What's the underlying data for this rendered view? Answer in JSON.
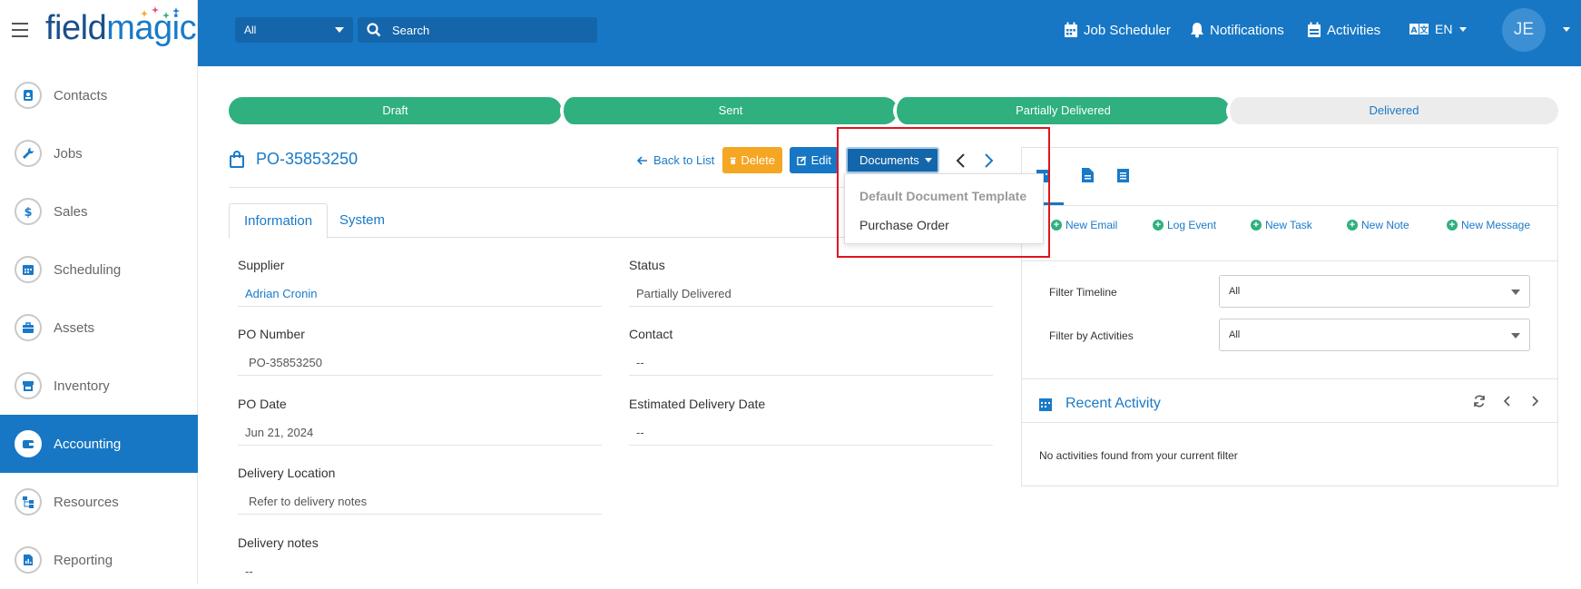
{
  "app": {
    "logo_part1": "field",
    "logo_part2": "magic"
  },
  "sidebar": {
    "items": [
      {
        "label": "Contacts",
        "icon": "contact-card-icon"
      },
      {
        "label": "Jobs",
        "icon": "wrench-icon"
      },
      {
        "label": "Sales",
        "icon": "dollar-icon"
      },
      {
        "label": "Scheduling",
        "icon": "calendar-icon"
      },
      {
        "label": "Assets",
        "icon": "briefcase-icon"
      },
      {
        "label": "Inventory",
        "icon": "store-icon"
      },
      {
        "label": "Accounting",
        "icon": "wallet-icon",
        "active": true
      },
      {
        "label": "Resources",
        "icon": "hierarchy-icon"
      },
      {
        "label": "Reporting",
        "icon": "report-icon"
      }
    ]
  },
  "topbar": {
    "scope_select": "All",
    "search_placeholder": "Search",
    "job_scheduler": "Job Scheduler",
    "notifications": "Notifications",
    "activities": "Activities",
    "language": "EN",
    "avatar_initials": "JE"
  },
  "steps": [
    {
      "label": "Draft",
      "state": "done"
    },
    {
      "label": "Sent",
      "state": "done"
    },
    {
      "label": "Partially Delivered",
      "state": "done"
    },
    {
      "label": "Delivered",
      "state": "todo"
    }
  ],
  "record": {
    "title": "PO-35853250",
    "back_label": "Back to List",
    "delete_label": "Delete",
    "edit_label": "Edit",
    "documents_label": "Documents"
  },
  "tabs": {
    "information": "Information",
    "system": "System"
  },
  "fields": {
    "supplier_label": "Supplier",
    "supplier_value": "Adrian Cronin",
    "status_label": "Status",
    "status_value": "Partially Delivered",
    "po_number_label": "PO Number",
    "po_number_value": "PO-35853250",
    "contact_label": "Contact",
    "contact_value": "--",
    "po_date_label": "PO Date",
    "po_date_value": "Jun 21, 2024",
    "est_delivery_label": "Estimated Delivery Date",
    "est_delivery_value": "--",
    "delivery_location_label": "Delivery Location",
    "delivery_location_value": "Refer to delivery notes",
    "delivery_notes_label": "Delivery notes",
    "delivery_notes_value": "--"
  },
  "timeline": {
    "actions": [
      "New Email",
      "Log Event",
      "New Task",
      "New Note",
      "New Message"
    ],
    "filter_timeline_label": "Filter Timeline",
    "filter_timeline_value": "All",
    "filter_activities_label": "Filter by Activities",
    "filter_activities_value": "All",
    "recent_title": "Recent Activity",
    "empty_message": "No activities found from your current filter"
  },
  "documents_menu": {
    "header": "Default Document Template",
    "item": "Purchase Order"
  },
  "colors": {
    "primary": "#1777c4",
    "success": "#2fb07e",
    "warning": "#f5a623",
    "highlight": "#e0141e"
  }
}
